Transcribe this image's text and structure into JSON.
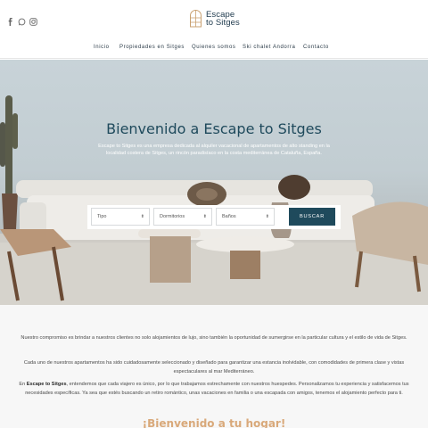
{
  "brand": {
    "name_line1": "Escape",
    "name_line2": "to Sitges",
    "accent": "#c9a070",
    "primary": "#1f4a5c"
  },
  "social": [
    {
      "icon": "facebook-icon"
    },
    {
      "icon": "whatsapp-icon"
    },
    {
      "icon": "instagram-icon"
    }
  ],
  "nav": {
    "items": [
      "Inicio",
      "Propiedades en Sitges",
      "Quienes somos",
      "Ski chalet Andorra",
      "Contacto"
    ]
  },
  "hero": {
    "title": "Bienvenido a Escape to Sitges",
    "text": "Escape to Sitges es una empresa dedicada al alquiler vacacional de apartamentos de alto standing en la localidad costera de Sitges, un rincón paradisíaco en la costa mediterránea de Cataluña, España."
  },
  "search": {
    "type_label": "Tipo",
    "bedrooms_label": "Dormitorios",
    "bathrooms_label": "Baños",
    "button_label": "BUSCAR"
  },
  "content": {
    "p1": "Nuestro compromiso es brindar a nuestros clientes no solo alojamientos de lujo, sino también la oportunidad de sumergirse en la particular cultura y el estilo de vida de Sitges.",
    "p2": "Cada uno de nuestros apartamentos ha sido cuidadosamente seleccionado y diseñado para garantizar una estancia inolvidable, con comodidades de primera clase y vistas espectaculares al mar Mediterráneo.",
    "p3_prefix": "En ",
    "p3_bold": "Escape to Sitges",
    "p3_rest": ", entendemos que cada viajero es único, por lo que trabajamos estrechamente con nuestros huespedes. Personalizamos tu experiencia y satisfacemos tus necesidades específicas. Ya sea que estés buscando un retiro romántico, unas vacaciones en familia o una escapada con amigos, tenemos el alojamiento perfecto para ti.",
    "welcome": "¡Bienvenido a tu hogar!"
  }
}
